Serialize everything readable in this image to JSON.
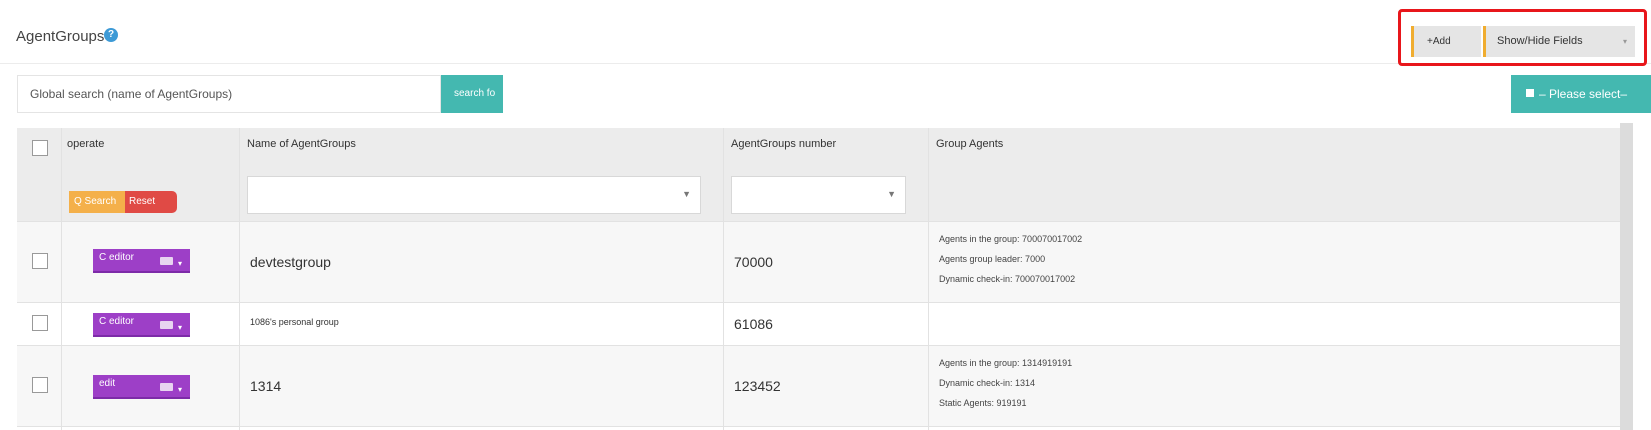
{
  "header": {
    "title": "AgentGroups",
    "help_icon": "?",
    "add_label": "+Add",
    "fields_label": "Show/Hide Fields",
    "caret": "▾"
  },
  "highlight_color": "#e8161b",
  "search": {
    "placeholder": "Global search (name of AgentGroups)",
    "button_label": "search fo",
    "select_label": "– Please select–"
  },
  "table": {
    "columns": [
      "operate",
      "Name of AgentGroups",
      "AgentGroups number",
      "Group Agents"
    ],
    "filter_search_label": "Q Search",
    "filter_reset_label": "Reset",
    "filter_arrow": "▼",
    "rows": [
      {
        "action": "C editor",
        "name": "devtestgroup",
        "number": "70000",
        "agents": [
          "Agents in the group: 700070017002",
          "Agents group leader: 7000",
          "Dynamic check-in: 700070017002"
        ]
      },
      {
        "action": "C editor",
        "name": "1086's personal group",
        "number": "61086",
        "agents": []
      },
      {
        "action": "edit",
        "name": "1314",
        "number": "123452",
        "agents": [
          "Agents in the group: 1314919191",
          "Dynamic check-in: 1314",
          "Static Agents: 919191"
        ]
      }
    ]
  },
  "colors": {
    "teal": "#44b8b0",
    "purple": "#9d3fc7",
    "orange": "#f4b04a",
    "red": "#e04a45"
  }
}
